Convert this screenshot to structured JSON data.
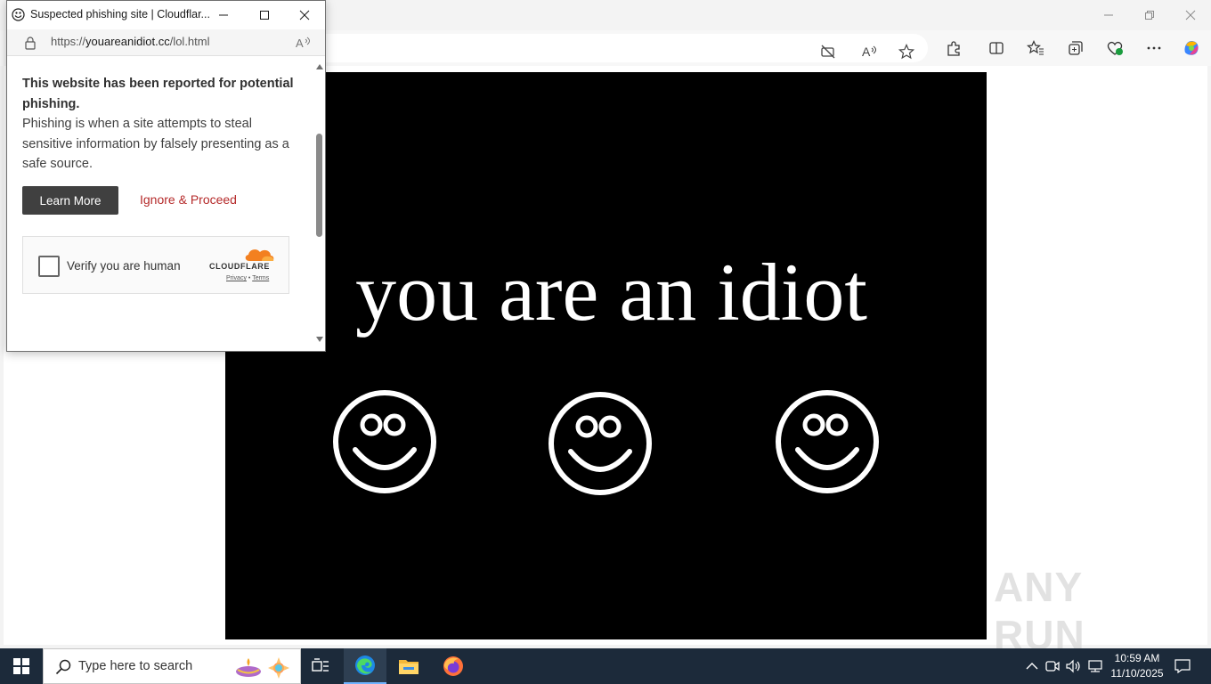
{
  "popup": {
    "title": "Suspected phishing site | Cloudflar...",
    "url_prefix": "https://",
    "url_domain": "youareanidiot.cc",
    "url_path": "/lol.html",
    "warning_title": "This website has been reported for potential phishing.",
    "warning_text": "Phishing is when a site attempts to steal sensitive information by falsely presenting as a safe source.",
    "learn_more_label": "Learn More",
    "ignore_label": "Ignore & Proceed",
    "captcha_label": "Verify you are human",
    "cloudflare_logo": "CLOUDFLARE",
    "privacy_label": "Privacy",
    "separator": "•",
    "terms_label": "Terms"
  },
  "page": {
    "headline": "you are an idiot"
  },
  "taskbar": {
    "search_placeholder": "Type here to search",
    "time": "10:59 AM",
    "date": "11/10/2025"
  },
  "watermark": "ANY RUN",
  "colors": {
    "popup_button": "#404040",
    "ignore_link": "#b52a2a",
    "page_background": "#000000",
    "taskbar": "#1c2a3a"
  }
}
